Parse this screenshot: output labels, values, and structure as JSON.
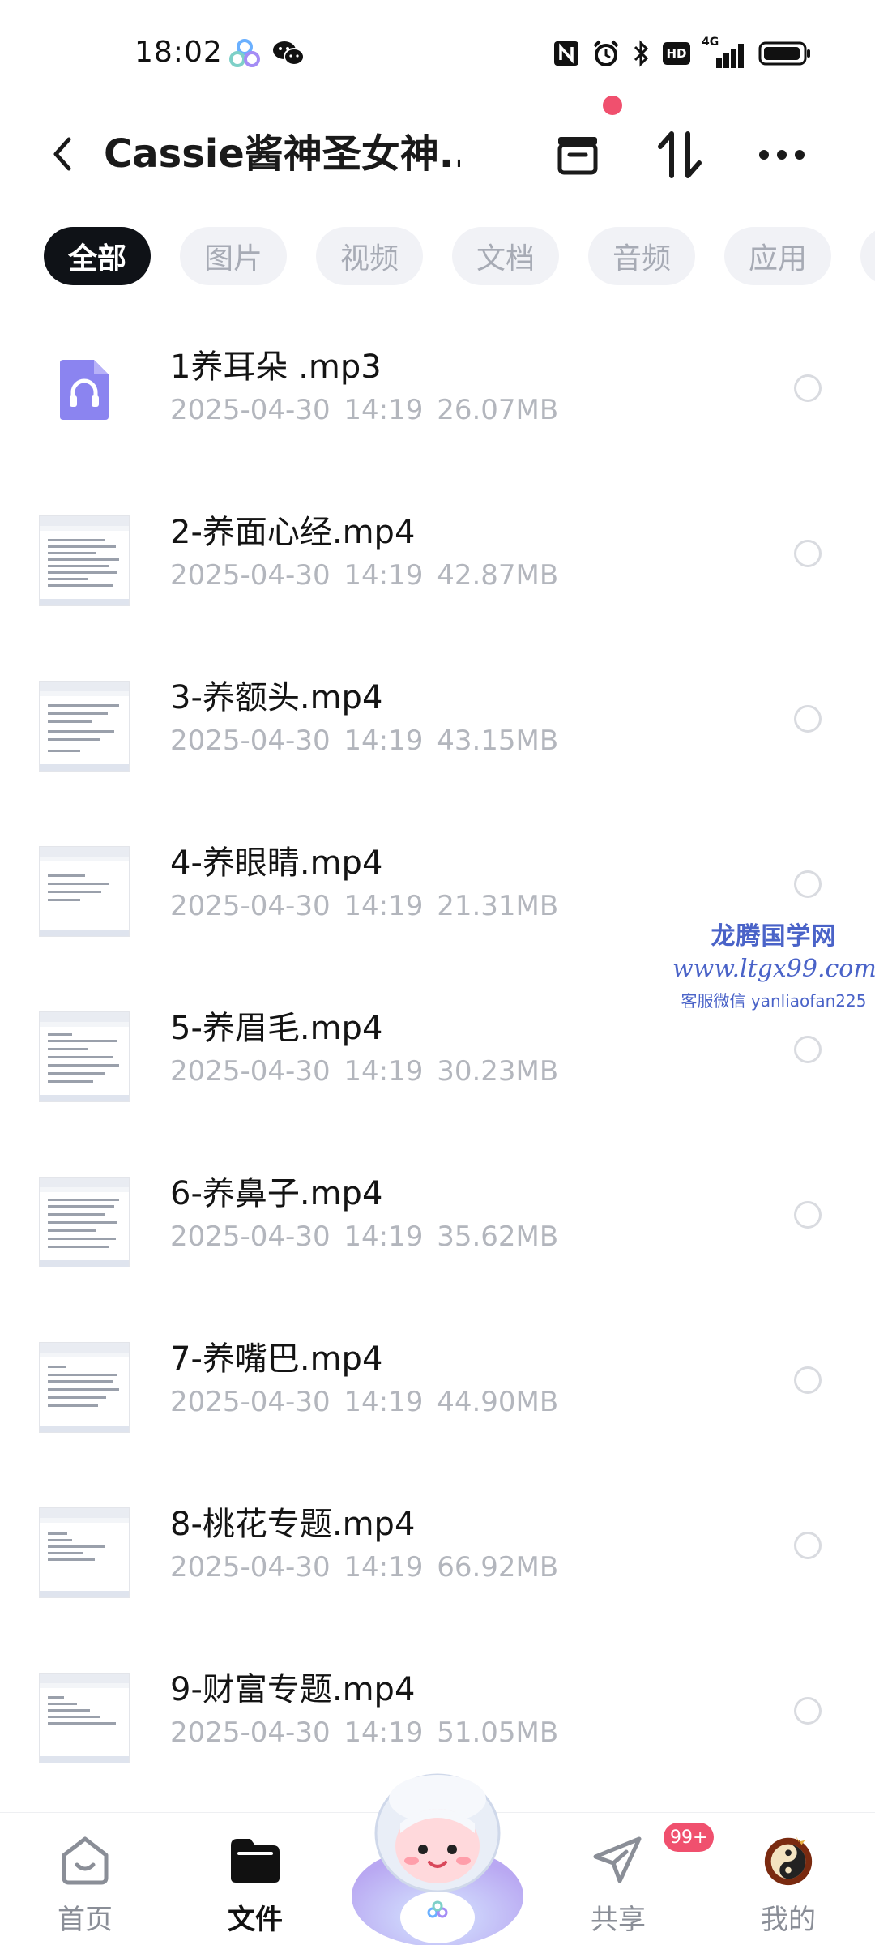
{
  "status_bar": {
    "time": "18:02",
    "icons": [
      "nfc-icon",
      "alarm-icon",
      "bluetooth-icon",
      "hd-icon",
      "4g-signal-icon",
      "battery-icon"
    ],
    "hd_label": "HD",
    "network_label": "4G"
  },
  "header": {
    "title": "Cassie酱神圣女神...",
    "has_notification_dot": true
  },
  "tabs": [
    {
      "label": "全部",
      "active": true
    },
    {
      "label": "图片",
      "active": false
    },
    {
      "label": "视频",
      "active": false
    },
    {
      "label": "文档",
      "active": false
    },
    {
      "label": "音频",
      "active": false
    },
    {
      "label": "应用",
      "active": false
    }
  ],
  "files": [
    {
      "name": "1养耳朵 .mp3",
      "date": "2025-04-30",
      "time": "14:19",
      "size": "26.07MB",
      "thumb": "audio"
    },
    {
      "name": "2-养面心经.mp4",
      "date": "2025-04-30",
      "time": "14:19",
      "size": "42.87MB",
      "thumb": "doc"
    },
    {
      "name": "3-养额头.mp4",
      "date": "2025-04-30",
      "time": "14:19",
      "size": "43.15MB",
      "thumb": "doc"
    },
    {
      "name": "4-养眼睛.mp4",
      "date": "2025-04-30",
      "time": "14:19",
      "size": "21.31MB",
      "thumb": "doc"
    },
    {
      "name": "5-养眉毛.mp4",
      "date": "2025-04-30",
      "time": "14:19",
      "size": "30.23MB",
      "thumb": "doc"
    },
    {
      "name": "6-养鼻子.mp4",
      "date": "2025-04-30",
      "time": "14:19",
      "size": "35.62MB",
      "thumb": "doc"
    },
    {
      "name": "7-养嘴巴.mp4",
      "date": "2025-04-30",
      "time": "14:19",
      "size": "44.90MB",
      "thumb": "doc"
    },
    {
      "name": "8-桃花专题.mp4",
      "date": "2025-04-30",
      "time": "14:19",
      "size": "66.92MB",
      "thumb": "doc"
    },
    {
      "name": "9-财富专题.mp4",
      "date": "2025-04-30",
      "time": "14:19",
      "size": "51.05MB",
      "thumb": "doc"
    }
  ],
  "watermark": {
    "line1": "龙腾国学网",
    "line2": "www.ltgx99.com",
    "line3": "客服微信 yanliaofan225"
  },
  "bottom_nav": {
    "home": {
      "label": "首页"
    },
    "files": {
      "label": "文件",
      "active": true
    },
    "share": {
      "label": "共享",
      "badge": "99+"
    },
    "mine": {
      "label": "我的"
    }
  },
  "colors": {
    "accent_dark": "#0f1217",
    "badge_red": "#f0506e",
    "audio_icon": "#8b84f0",
    "muted_text": "#b3b6bd",
    "tab_bg": "#f1f2f6"
  }
}
